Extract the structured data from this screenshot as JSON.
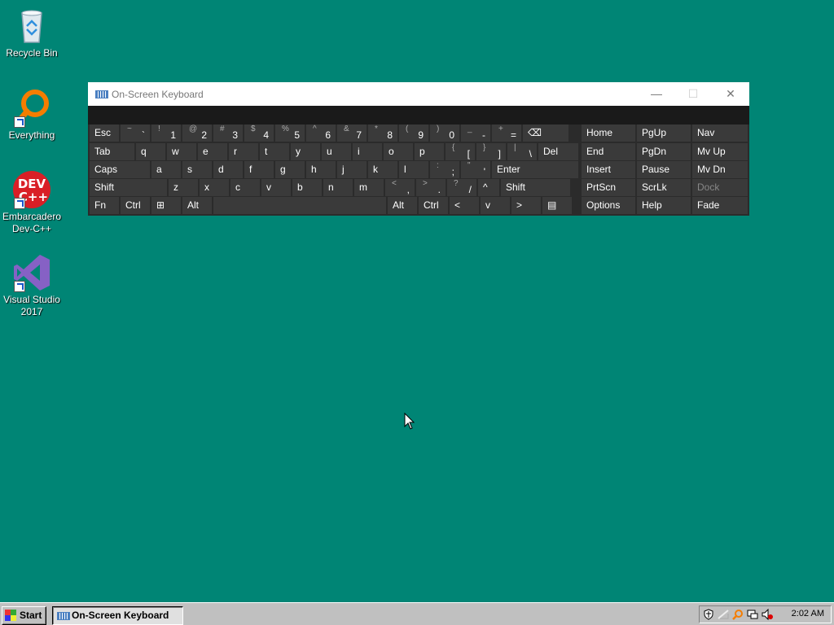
{
  "desktop": {
    "icons": [
      {
        "label": "Recycle Bin",
        "icon": "recycle-bin-icon"
      },
      {
        "label": "Everything",
        "icon": "everything-search-icon"
      },
      {
        "label1": "Embarcadero",
        "label2": "Dev-C++",
        "icon": "devcpp-icon",
        "logo1": "DEV",
        "logo2": "C++"
      },
      {
        "label1": "Visual Studio",
        "label2": "2017",
        "icon": "visual-studio-icon"
      }
    ]
  },
  "osk": {
    "title": "On-Screen Keyboard",
    "controls": {
      "minimize": "—",
      "maximize": "☐",
      "close": "✕"
    },
    "rows": {
      "r1": [
        {
          "t": "Esc"
        },
        {
          "s": "~",
          "m": "`"
        },
        {
          "s": "!",
          "m": "1"
        },
        {
          "s": "@",
          "m": "2"
        },
        {
          "s": "#",
          "m": "3"
        },
        {
          "s": "$",
          "m": "4"
        },
        {
          "s": "%",
          "m": "5"
        },
        {
          "s": "^",
          "m": "6"
        },
        {
          "s": "&",
          "m": "7"
        },
        {
          "s": "*",
          "m": "8"
        },
        {
          "s": "(",
          "m": "9"
        },
        {
          "s": ")",
          "m": "0"
        },
        {
          "s": "_",
          "m": "-"
        },
        {
          "s": "+",
          "m": "="
        },
        {
          "t": "⌫"
        }
      ],
      "r2": [
        {
          "t": "Tab"
        },
        {
          "t": "q"
        },
        {
          "t": "w"
        },
        {
          "t": "e"
        },
        {
          "t": "r"
        },
        {
          "t": "t"
        },
        {
          "t": "y"
        },
        {
          "t": "u"
        },
        {
          "t": "i"
        },
        {
          "t": "o"
        },
        {
          "t": "p"
        },
        {
          "s": "{",
          "m": "["
        },
        {
          "s": "}",
          "m": "]"
        },
        {
          "s": "|",
          "m": "\\"
        },
        {
          "t": "Del"
        }
      ],
      "r3": [
        {
          "t": "Caps"
        },
        {
          "t": "a"
        },
        {
          "t": "s"
        },
        {
          "t": "d"
        },
        {
          "t": "f"
        },
        {
          "t": "g"
        },
        {
          "t": "h"
        },
        {
          "t": "j"
        },
        {
          "t": "k"
        },
        {
          "t": "l"
        },
        {
          "s": ":",
          "m": ";"
        },
        {
          "s": "\"",
          "m": "'"
        },
        {
          "t": "Enter"
        }
      ],
      "r4": [
        {
          "t": "Shift"
        },
        {
          "t": "z"
        },
        {
          "t": "x"
        },
        {
          "t": "c"
        },
        {
          "t": "v"
        },
        {
          "t": "b"
        },
        {
          "t": "n"
        },
        {
          "t": "m"
        },
        {
          "s": "<",
          "m": ","
        },
        {
          "s": ">",
          "m": "."
        },
        {
          "s": "?",
          "m": "/"
        },
        {
          "t": "^"
        },
        {
          "t": "Shift"
        }
      ],
      "r5": [
        {
          "t": "Fn"
        },
        {
          "t": "Ctrl"
        },
        {
          "t": "⊞"
        },
        {
          "t": "Alt"
        },
        {
          "t": ""
        },
        {
          "t": "Alt"
        },
        {
          "t": "Ctrl"
        },
        {
          "t": "<"
        },
        {
          "t": "v"
        },
        {
          "t": ">"
        },
        {
          "t": "▤"
        }
      ]
    },
    "nav": [
      [
        "Home",
        "PgUp",
        "Nav"
      ],
      [
        "End",
        "PgDn",
        "Mv Up"
      ],
      [
        "Insert",
        "Pause",
        "Mv Dn"
      ],
      [
        "PrtScn",
        "ScrLk",
        "Dock"
      ],
      [
        "Options",
        "Help",
        "Fade"
      ]
    ]
  },
  "taskbar": {
    "start_label": "Start",
    "window_button": "On-Screen Keyboard",
    "clock": "2:02 AM"
  }
}
